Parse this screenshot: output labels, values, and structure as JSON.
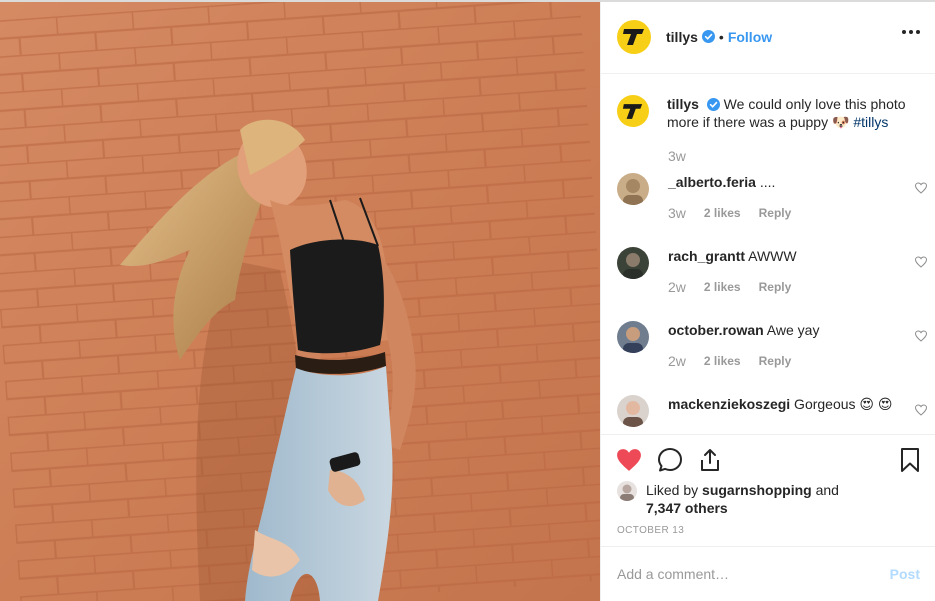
{
  "post": {
    "image_icon": "photo-girl-brick-wall",
    "account": "tillys",
    "header_dot": "•",
    "follow_label": "Follow",
    "more_icon": "more-horizontal-icon",
    "verified_color": "#3897f0"
  },
  "caption": {
    "username": "tillys",
    "text_before": " We could only love this photo more if there was a puppy ",
    "emoji": "🐶",
    "hashtag": "#tillys",
    "time": "3w"
  },
  "comments": [
    {
      "username": "_alberto.feria",
      "text": " ....",
      "age": "3w",
      "likes": "2 likes",
      "reply": "Reply"
    },
    {
      "username": "rach_grantt",
      "text": " AWWW",
      "age": "2w",
      "likes": "2 likes",
      "reply": "Reply"
    },
    {
      "username": "october.rowan",
      "text": " Awe yay",
      "age": "2w",
      "likes": "2 likes",
      "reply": "Reply"
    },
    {
      "username": "mackenziekoszegi",
      "text": " Gorgeous 😍 😍",
      "age": "",
      "likes": "",
      "reply": ""
    }
  ],
  "actions": {
    "like_icon": "heart-filled-icon",
    "comment_icon": "comment-bubble-icon",
    "share_icon": "share-upload-icon",
    "save_icon": "bookmark-icon",
    "like_color": "#ed4956"
  },
  "likes": {
    "prefix": "Liked by ",
    "user": "sugarnshopping",
    "middle": " and ",
    "count": "7,347 others"
  },
  "date": "OCTOBER 13",
  "add_comment": {
    "placeholder": "Add a comment…",
    "post_label": "Post"
  }
}
